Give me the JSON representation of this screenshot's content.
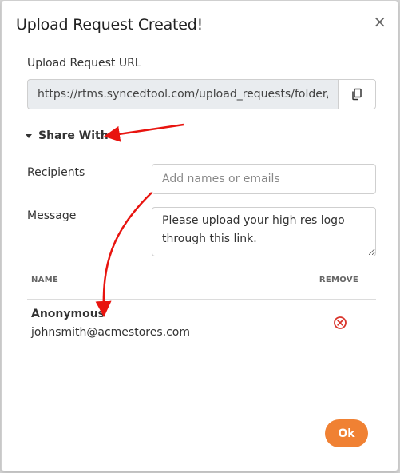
{
  "dialog": {
    "title": "Upload Request Created!",
    "close_glyph": "×"
  },
  "url_section": {
    "label": "Upload Request URL",
    "value": "https://rtms.syncedtool.com/upload_requests/folder/c",
    "copy_icon": "copy-icon"
  },
  "share": {
    "toggle_label": "Share With",
    "recipients_label": "Recipients",
    "recipients_placeholder": "Add names or emails",
    "message_label": "Message",
    "message_value": "Please upload your high res logo through this link."
  },
  "table": {
    "headers": {
      "name": "NAME",
      "remove": "REMOVE"
    },
    "rows": [
      {
        "name": "Anonymous",
        "email": "johnsmith@acmestores.com"
      }
    ]
  },
  "footer": {
    "ok_label": "Ok"
  },
  "colors": {
    "accent": "#f08133",
    "remove_icon": "#d9342b",
    "annotation_arrow": "#e8140f"
  }
}
